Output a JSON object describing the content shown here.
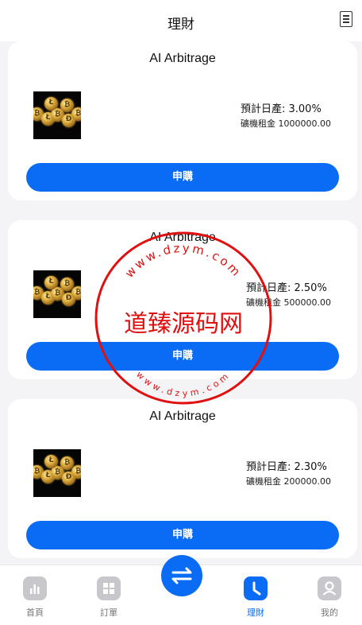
{
  "header": {
    "title": "理財",
    "menu_icon": "document-icon"
  },
  "products": [
    {
      "name": "AI Arbitrage",
      "rate_label": "預計日產: 3.00%",
      "rent_label": "礦機租金 1000000.00",
      "button": "申購"
    },
    {
      "name": "AI Arbitrage",
      "rate_label": "預計日產: 2.50%",
      "rent_label": "礦機租金 500000.00",
      "button": "申購"
    },
    {
      "name": "AI Arbitrage",
      "rate_label": "預計日產: 2.30%",
      "rent_label": "礦機租金 200000.00",
      "button": "申購"
    }
  ],
  "watermark": {
    "text": "道臻源码网",
    "ring_text": "www.dzym.com"
  },
  "tabbar": {
    "items": [
      {
        "label": "首頁",
        "icon": "bar-chart-icon"
      },
      {
        "label": "訂單",
        "icon": "grid-icon"
      },
      {
        "label": "理財",
        "icon": "clock-icon"
      },
      {
        "label": "我的",
        "icon": "user-icon"
      }
    ],
    "center_icon": "swap-arrows-icon"
  },
  "colors": {
    "accent": "#0a6cf5",
    "inactive_icon": "#c7c7cc",
    "background": "#f4f4f6",
    "watermark": "#e01010"
  }
}
